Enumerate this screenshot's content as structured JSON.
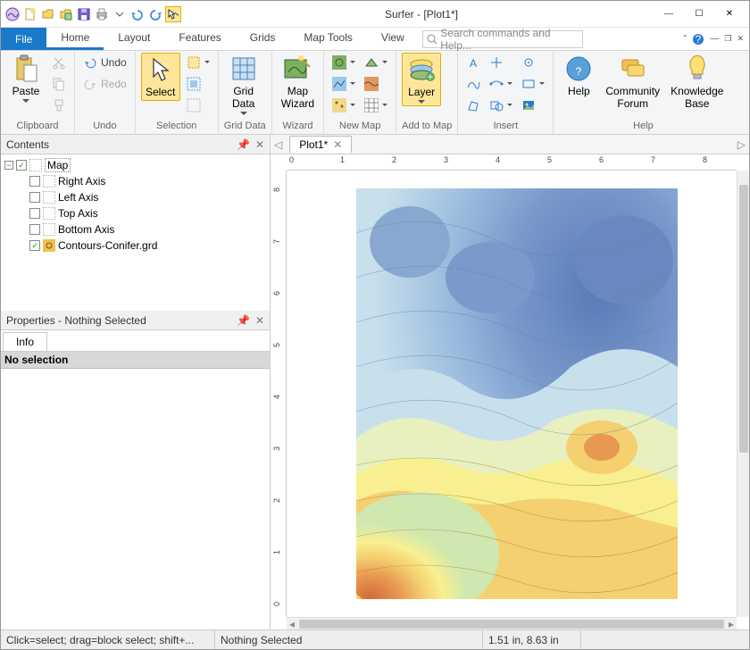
{
  "title": "Surfer - [Plot1*]",
  "quick_access": [
    "new",
    "open-folder",
    "open-multi",
    "save",
    "print",
    "down",
    "undo-arrow",
    "redo-arrow",
    "cursor-dd"
  ],
  "tabs": {
    "file": "File",
    "items": [
      "Home",
      "Layout",
      "Features",
      "Grids",
      "Map Tools",
      "View"
    ],
    "active": "Home"
  },
  "search_placeholder": "Search commands and Help...",
  "ribbon": {
    "clipboard": {
      "label": "Clipboard",
      "paste": "Paste"
    },
    "undo": {
      "label": "Undo",
      "undo": "Undo",
      "redo": "Redo"
    },
    "selection": {
      "label": "Selection",
      "select": "Select"
    },
    "grid_data": {
      "label": "Grid Data",
      "btn": "Grid\nData"
    },
    "wizard": {
      "label": "Wizard",
      "btn": "Map\nWizard"
    },
    "new_map": {
      "label": "New Map"
    },
    "add_to_map": {
      "label": "Add to Map",
      "layer": "Layer"
    },
    "insert": {
      "label": "Insert"
    },
    "help": {
      "label": "Help",
      "help": "Help",
      "forum": "Community\nForum",
      "kb": "Knowledge\nBase"
    }
  },
  "contents": {
    "title": "Contents",
    "root": "Map",
    "items": [
      "Right Axis",
      "Left Axis",
      "Top Axis",
      "Bottom Axis",
      "Contours-Conifer.grd"
    ]
  },
  "properties": {
    "title": "Properties - Nothing Selected",
    "tab": "Info",
    "body": "No selection"
  },
  "doc": {
    "tab": "Plot1*"
  },
  "ruler": {
    "h": [
      "0",
      "1",
      "2",
      "3",
      "4",
      "5",
      "6",
      "7",
      "8"
    ],
    "v": [
      "0",
      "1",
      "2",
      "3",
      "4",
      "5",
      "6",
      "7",
      "8"
    ]
  },
  "status": {
    "hint": "Click=select; drag=block select; shift+...",
    "sel": "Nothing Selected",
    "coords": "1.51 in, 8.63 in"
  }
}
